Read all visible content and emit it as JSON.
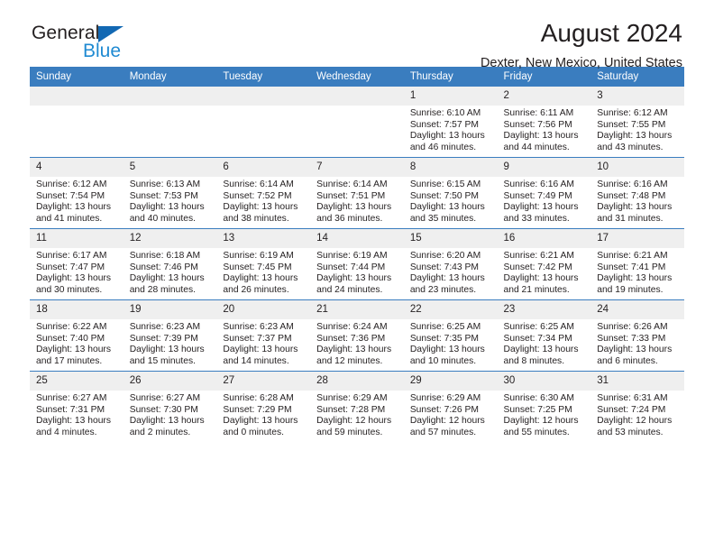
{
  "brand": {
    "name_top": "General",
    "name_bottom": "Blue",
    "triangle_color": "#1268b3",
    "blue_color": "#1f8ad2"
  },
  "header": {
    "title": "August 2024",
    "location": "Dexter, New Mexico, United States"
  },
  "colors": {
    "header_bar": "#3a7dbf",
    "daynum_bg": "#efefef",
    "text": "#231f20"
  },
  "weekdays": [
    "Sunday",
    "Monday",
    "Tuesday",
    "Wednesday",
    "Thursday",
    "Friday",
    "Saturday"
  ],
  "weeks": [
    [
      {
        "day": "",
        "empty": true,
        "sunrise": "",
        "sunset": "",
        "daylight_1": "",
        "daylight_2": ""
      },
      {
        "day": "",
        "empty": true,
        "sunrise": "",
        "sunset": "",
        "daylight_1": "",
        "daylight_2": ""
      },
      {
        "day": "",
        "empty": true,
        "sunrise": "",
        "sunset": "",
        "daylight_1": "",
        "daylight_2": ""
      },
      {
        "day": "",
        "empty": true,
        "sunrise": "",
        "sunset": "",
        "daylight_1": "",
        "daylight_2": ""
      },
      {
        "day": "1",
        "empty": false,
        "sunrise": "Sunrise: 6:10 AM",
        "sunset": "Sunset: 7:57 PM",
        "daylight_1": "Daylight: 13 hours",
        "daylight_2": "and 46 minutes."
      },
      {
        "day": "2",
        "empty": false,
        "sunrise": "Sunrise: 6:11 AM",
        "sunset": "Sunset: 7:56 PM",
        "daylight_1": "Daylight: 13 hours",
        "daylight_2": "and 44 minutes."
      },
      {
        "day": "3",
        "empty": false,
        "sunrise": "Sunrise: 6:12 AM",
        "sunset": "Sunset: 7:55 PM",
        "daylight_1": "Daylight: 13 hours",
        "daylight_2": "and 43 minutes."
      }
    ],
    [
      {
        "day": "4",
        "empty": false,
        "sunrise": "Sunrise: 6:12 AM",
        "sunset": "Sunset: 7:54 PM",
        "daylight_1": "Daylight: 13 hours",
        "daylight_2": "and 41 minutes."
      },
      {
        "day": "5",
        "empty": false,
        "sunrise": "Sunrise: 6:13 AM",
        "sunset": "Sunset: 7:53 PM",
        "daylight_1": "Daylight: 13 hours",
        "daylight_2": "and 40 minutes."
      },
      {
        "day": "6",
        "empty": false,
        "sunrise": "Sunrise: 6:14 AM",
        "sunset": "Sunset: 7:52 PM",
        "daylight_1": "Daylight: 13 hours",
        "daylight_2": "and 38 minutes."
      },
      {
        "day": "7",
        "empty": false,
        "sunrise": "Sunrise: 6:14 AM",
        "sunset": "Sunset: 7:51 PM",
        "daylight_1": "Daylight: 13 hours",
        "daylight_2": "and 36 minutes."
      },
      {
        "day": "8",
        "empty": false,
        "sunrise": "Sunrise: 6:15 AM",
        "sunset": "Sunset: 7:50 PM",
        "daylight_1": "Daylight: 13 hours",
        "daylight_2": "and 35 minutes."
      },
      {
        "day": "9",
        "empty": false,
        "sunrise": "Sunrise: 6:16 AM",
        "sunset": "Sunset: 7:49 PM",
        "daylight_1": "Daylight: 13 hours",
        "daylight_2": "and 33 minutes."
      },
      {
        "day": "10",
        "empty": false,
        "sunrise": "Sunrise: 6:16 AM",
        "sunset": "Sunset: 7:48 PM",
        "daylight_1": "Daylight: 13 hours",
        "daylight_2": "and 31 minutes."
      }
    ],
    [
      {
        "day": "11",
        "empty": false,
        "sunrise": "Sunrise: 6:17 AM",
        "sunset": "Sunset: 7:47 PM",
        "daylight_1": "Daylight: 13 hours",
        "daylight_2": "and 30 minutes."
      },
      {
        "day": "12",
        "empty": false,
        "sunrise": "Sunrise: 6:18 AM",
        "sunset": "Sunset: 7:46 PM",
        "daylight_1": "Daylight: 13 hours",
        "daylight_2": "and 28 minutes."
      },
      {
        "day": "13",
        "empty": false,
        "sunrise": "Sunrise: 6:19 AM",
        "sunset": "Sunset: 7:45 PM",
        "daylight_1": "Daylight: 13 hours",
        "daylight_2": "and 26 minutes."
      },
      {
        "day": "14",
        "empty": false,
        "sunrise": "Sunrise: 6:19 AM",
        "sunset": "Sunset: 7:44 PM",
        "daylight_1": "Daylight: 13 hours",
        "daylight_2": "and 24 minutes."
      },
      {
        "day": "15",
        "empty": false,
        "sunrise": "Sunrise: 6:20 AM",
        "sunset": "Sunset: 7:43 PM",
        "daylight_1": "Daylight: 13 hours",
        "daylight_2": "and 23 minutes."
      },
      {
        "day": "16",
        "empty": false,
        "sunrise": "Sunrise: 6:21 AM",
        "sunset": "Sunset: 7:42 PM",
        "daylight_1": "Daylight: 13 hours",
        "daylight_2": "and 21 minutes."
      },
      {
        "day": "17",
        "empty": false,
        "sunrise": "Sunrise: 6:21 AM",
        "sunset": "Sunset: 7:41 PM",
        "daylight_1": "Daylight: 13 hours",
        "daylight_2": "and 19 minutes."
      }
    ],
    [
      {
        "day": "18",
        "empty": false,
        "sunrise": "Sunrise: 6:22 AM",
        "sunset": "Sunset: 7:40 PM",
        "daylight_1": "Daylight: 13 hours",
        "daylight_2": "and 17 minutes."
      },
      {
        "day": "19",
        "empty": false,
        "sunrise": "Sunrise: 6:23 AM",
        "sunset": "Sunset: 7:39 PM",
        "daylight_1": "Daylight: 13 hours",
        "daylight_2": "and 15 minutes."
      },
      {
        "day": "20",
        "empty": false,
        "sunrise": "Sunrise: 6:23 AM",
        "sunset": "Sunset: 7:37 PM",
        "daylight_1": "Daylight: 13 hours",
        "daylight_2": "and 14 minutes."
      },
      {
        "day": "21",
        "empty": false,
        "sunrise": "Sunrise: 6:24 AM",
        "sunset": "Sunset: 7:36 PM",
        "daylight_1": "Daylight: 13 hours",
        "daylight_2": "and 12 minutes."
      },
      {
        "day": "22",
        "empty": false,
        "sunrise": "Sunrise: 6:25 AM",
        "sunset": "Sunset: 7:35 PM",
        "daylight_1": "Daylight: 13 hours",
        "daylight_2": "and 10 minutes."
      },
      {
        "day": "23",
        "empty": false,
        "sunrise": "Sunrise: 6:25 AM",
        "sunset": "Sunset: 7:34 PM",
        "daylight_1": "Daylight: 13 hours",
        "daylight_2": "and 8 minutes."
      },
      {
        "day": "24",
        "empty": false,
        "sunrise": "Sunrise: 6:26 AM",
        "sunset": "Sunset: 7:33 PM",
        "daylight_1": "Daylight: 13 hours",
        "daylight_2": "and 6 minutes."
      }
    ],
    [
      {
        "day": "25",
        "empty": false,
        "sunrise": "Sunrise: 6:27 AM",
        "sunset": "Sunset: 7:31 PM",
        "daylight_1": "Daylight: 13 hours",
        "daylight_2": "and 4 minutes."
      },
      {
        "day": "26",
        "empty": false,
        "sunrise": "Sunrise: 6:27 AM",
        "sunset": "Sunset: 7:30 PM",
        "daylight_1": "Daylight: 13 hours",
        "daylight_2": "and 2 minutes."
      },
      {
        "day": "27",
        "empty": false,
        "sunrise": "Sunrise: 6:28 AM",
        "sunset": "Sunset: 7:29 PM",
        "daylight_1": "Daylight: 13 hours",
        "daylight_2": "and 0 minutes."
      },
      {
        "day": "28",
        "empty": false,
        "sunrise": "Sunrise: 6:29 AM",
        "sunset": "Sunset: 7:28 PM",
        "daylight_1": "Daylight: 12 hours",
        "daylight_2": "and 59 minutes."
      },
      {
        "day": "29",
        "empty": false,
        "sunrise": "Sunrise: 6:29 AM",
        "sunset": "Sunset: 7:26 PM",
        "daylight_1": "Daylight: 12 hours",
        "daylight_2": "and 57 minutes."
      },
      {
        "day": "30",
        "empty": false,
        "sunrise": "Sunrise: 6:30 AM",
        "sunset": "Sunset: 7:25 PM",
        "daylight_1": "Daylight: 12 hours",
        "daylight_2": "and 55 minutes."
      },
      {
        "day": "31",
        "empty": false,
        "sunrise": "Sunrise: 6:31 AM",
        "sunset": "Sunset: 7:24 PM",
        "daylight_1": "Daylight: 12 hours",
        "daylight_2": "and 53 minutes."
      }
    ]
  ]
}
